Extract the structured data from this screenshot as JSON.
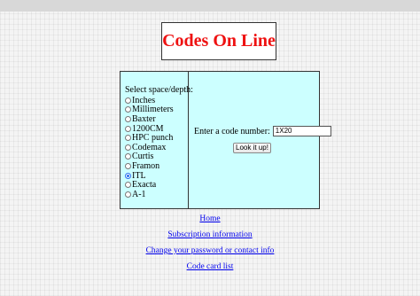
{
  "header": {
    "title": "Codes On Line"
  },
  "form": {
    "select_label": "Select space/depth:",
    "options": [
      {
        "label": "Inches",
        "checked": false
      },
      {
        "label": "Millimeters",
        "checked": false
      },
      {
        "label": "Baxter",
        "checked": false
      },
      {
        "label": "1200CM",
        "checked": false
      },
      {
        "label": "HPC punch",
        "checked": false
      },
      {
        "label": "Codemax",
        "checked": false
      },
      {
        "label": "Curtis",
        "checked": false
      },
      {
        "label": "Framon",
        "checked": false
      },
      {
        "label": "ITL",
        "checked": true
      },
      {
        "label": "Exacta",
        "checked": false
      },
      {
        "label": "A-1",
        "checked": false
      }
    ],
    "code_label": "Enter a code number:",
    "code_value": "1X20",
    "lookup_label": "Look it up!"
  },
  "links": {
    "home": "Home",
    "subscription": "Subscription information",
    "change_password": "Change your password or contact info",
    "code_card_list": "Code card list"
  },
  "colors": {
    "title": "#ee1111",
    "panel_background": "#ccffff",
    "link": "#0000ee"
  }
}
